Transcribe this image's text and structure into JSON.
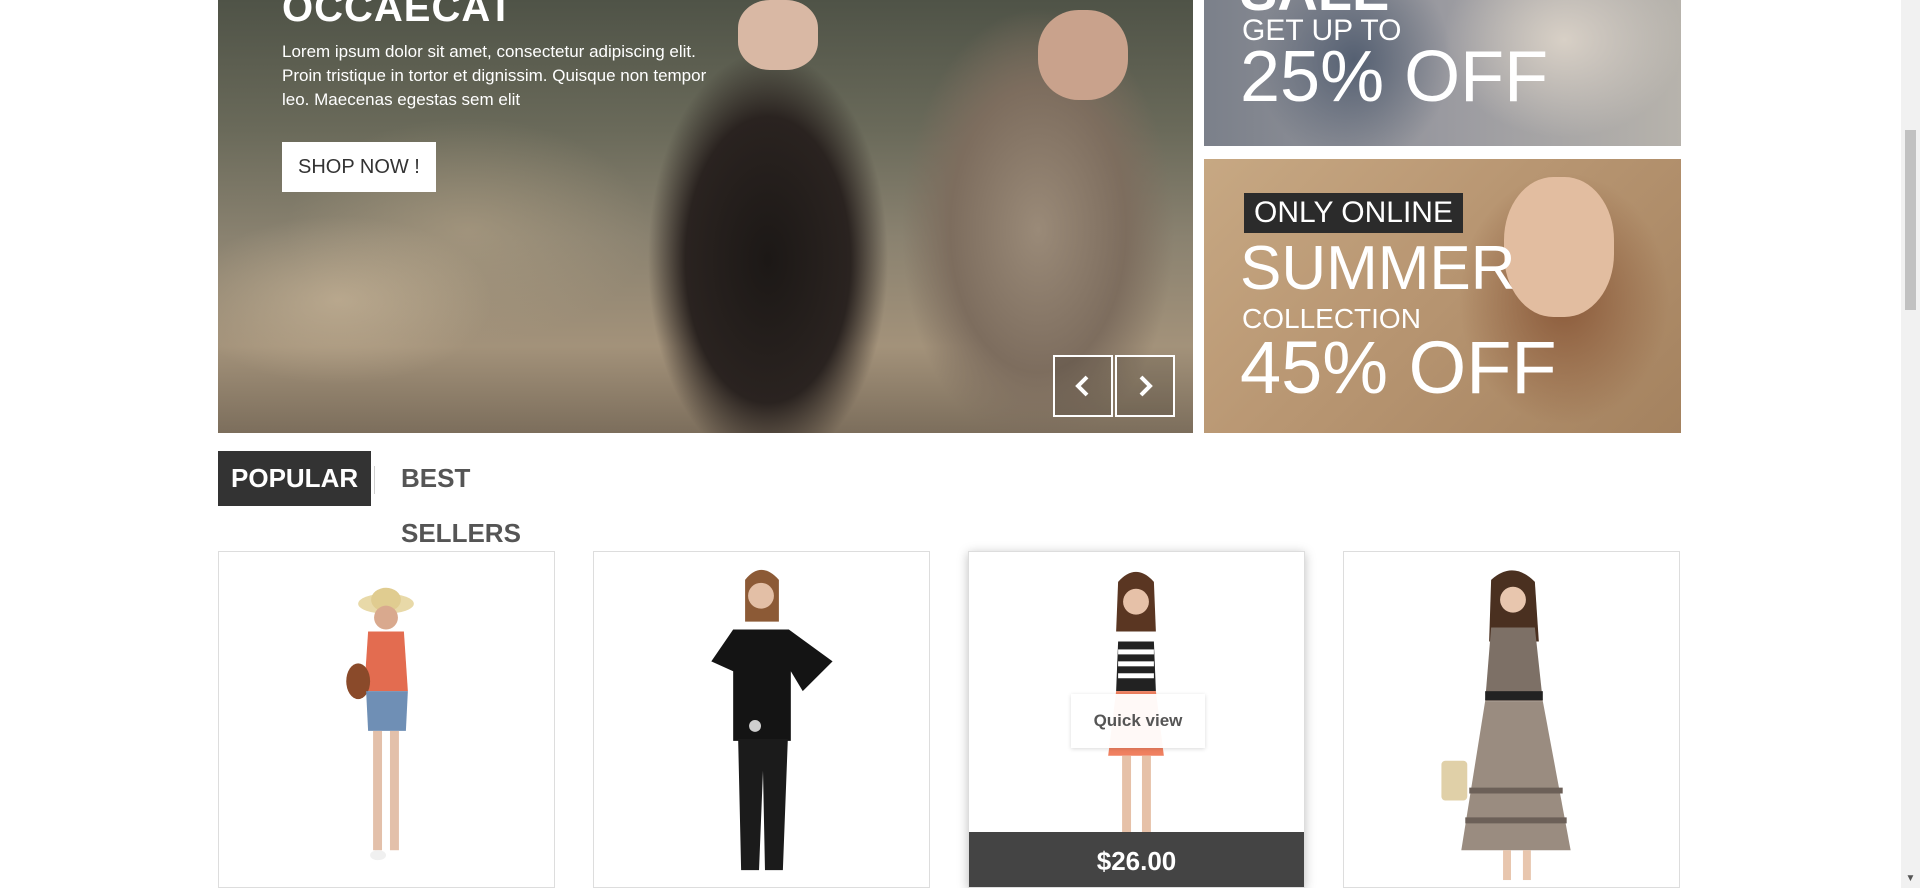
{
  "slider": {
    "title": "OCCAECAT",
    "text": "Lorem ipsum dolor sit amet, consectetur adipiscing elit. Proin tristique in tortor et dignissim. Quisque non tempor leo. Maecenas egestas sem elit",
    "button_label": "SHOP NOW !",
    "prev_icon": "chevron-left-icon",
    "next_icon": "chevron-right-icon"
  },
  "banners": {
    "top": {
      "sale": "SALE",
      "get_up_to": "GET UP TO",
      "off": "25% OFF"
    },
    "bottom": {
      "badge": "ONLY ONLINE",
      "headline": "SUMMER",
      "subheadline": "COLLECTION",
      "off": "45% OFF"
    }
  },
  "tabs": [
    {
      "label": "POPULAR",
      "active": true
    },
    {
      "label": "BEST SELLERS",
      "active": false
    }
  ],
  "products": [
    {
      "quick_view": "",
      "price": ""
    },
    {
      "quick_view": "",
      "price": ""
    },
    {
      "quick_view": "Quick view",
      "price": "$26.00"
    },
    {
      "quick_view": "",
      "price": ""
    }
  ],
  "colors": {
    "tab_active_bg": "#333333",
    "price_bar_bg": "#444444",
    "badge_bg": "#2b2b2b"
  }
}
